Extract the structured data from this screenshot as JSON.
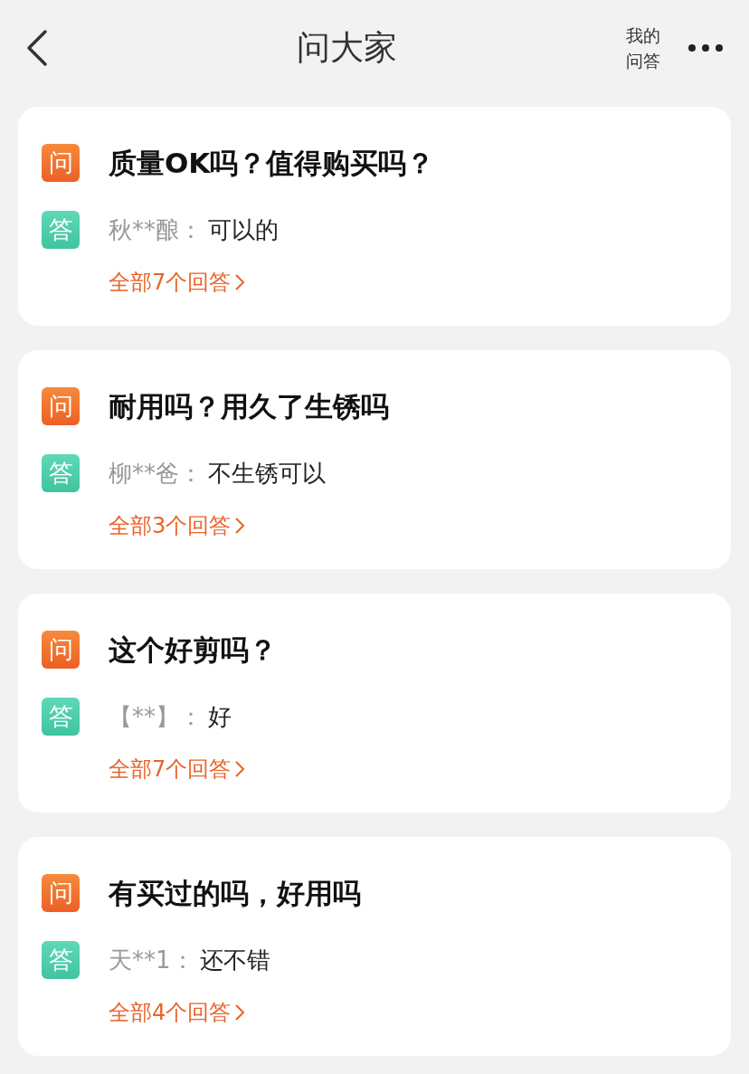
{
  "header": {
    "title": "问大家",
    "my_answers": [
      "我的",
      "问答"
    ]
  },
  "questions": [
    {
      "question_badge": "问",
      "question": "质量OK吗？值得购买吗？",
      "answer_badge": "答",
      "answerer": "秋**酿：",
      "answer": "可以的",
      "all_answers": "全部7个回答"
    },
    {
      "question_badge": "问",
      "question": "耐用吗？用久了生锈吗",
      "answer_badge": "答",
      "answerer": "柳**爸：",
      "answer": "不生锈可以",
      "all_answers": "全部3个回答"
    },
    {
      "question_badge": "问",
      "question": "这个好剪吗？",
      "answer_badge": "答",
      "answerer": "【**】：",
      "answer": "好",
      "all_answers": "全部7个回答"
    },
    {
      "question_badge": "问",
      "question": "有买过的吗，好用吗",
      "answer_badge": "答",
      "answerer": "天**1：",
      "answer": "还不错",
      "all_answers": "全部4个回答"
    }
  ]
}
